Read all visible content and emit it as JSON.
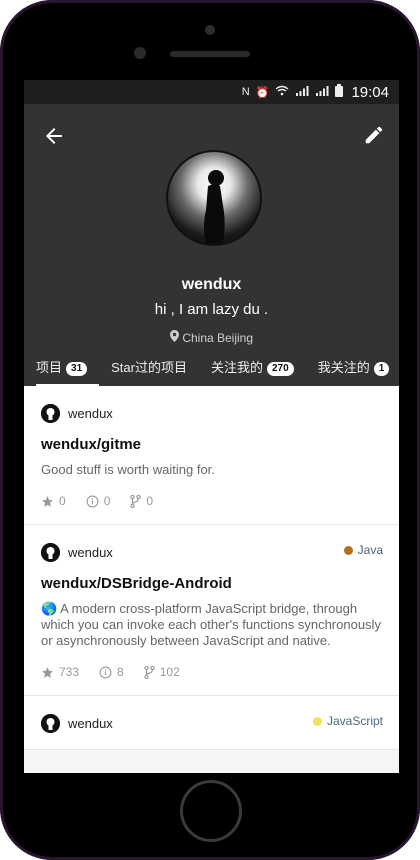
{
  "status_bar": {
    "time": "19:04"
  },
  "profile": {
    "username": "wendux",
    "bio": "hi , I am lazy du .",
    "location": "China Beijing"
  },
  "tabs": [
    {
      "label": "项目",
      "count": "31"
    },
    {
      "label": "Star过的项目",
      "count": ""
    },
    {
      "label": "关注我的",
      "count": "270"
    },
    {
      "label": "我关注的",
      "count": "1"
    }
  ],
  "repos": [
    {
      "owner": "wendux",
      "name": "wendux/gitme",
      "description": "Good stuff is worth waiting for.",
      "stars": "0",
      "issues": "0",
      "forks": "0",
      "language": "",
      "language_color": ""
    },
    {
      "owner": "wendux",
      "name": "wendux/DSBridge-Android",
      "description": "🌎 A modern cross-platform JavaScript bridge, through which you can invoke each other's functions synchronously or asynchronously between JavaScript and native.",
      "stars": "733",
      "issues": "8",
      "forks": "102",
      "language": "Java",
      "language_color": "#b07219"
    },
    {
      "owner": "wendux",
      "name": "",
      "description": "",
      "stars": "",
      "issues": "",
      "forks": "",
      "language": "JavaScript",
      "language_color": "#f1e05a"
    }
  ],
  "colors": {
    "header_bg": "#333333",
    "accent": "#ffffff"
  },
  "icons": {
    "back": "arrow-left-icon",
    "edit": "pencil-icon",
    "location": "map-pin-icon",
    "star": "star-icon",
    "issue": "info-circle-icon",
    "fork": "fork-icon"
  }
}
